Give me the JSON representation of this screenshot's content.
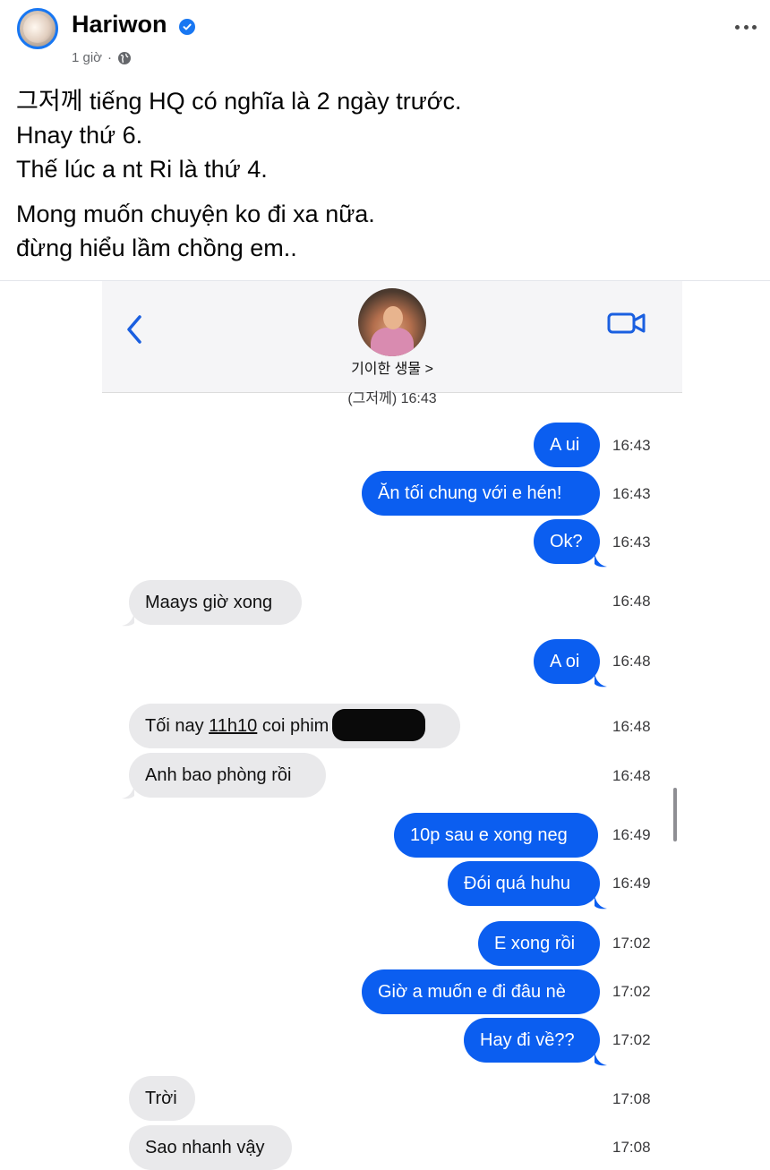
{
  "post": {
    "author": "Hariwon",
    "time": "1 giờ",
    "separator": "·",
    "lines_1": [
      "그저께 tiếng HQ có nghĩa là 2 ngày trước.",
      "Hnay thứ 6.",
      "Thế lúc a nt Ri là thứ 4."
    ],
    "lines_2": [
      "Mong muốn chuyện ko đi xa nữa.",
      "đừng hiểu lầm chồng em.."
    ]
  },
  "chat": {
    "contact_name": "기이한 생물 >",
    "day_label": "(그저께) 16:43",
    "messages": [
      {
        "dir": "out",
        "text": "A ui",
        "time": "16:43"
      },
      {
        "dir": "out",
        "text": "Ăn tối chung với e hén!",
        "time": "16:43"
      },
      {
        "dir": "out",
        "text": "Ok?",
        "time": "16:43"
      },
      {
        "dir": "in",
        "text": "Maays giờ xong",
        "time": "16:48"
      },
      {
        "dir": "out",
        "text": "A oi",
        "time": "16:48"
      },
      {
        "dir": "in",
        "text_pre": "Tối nay ",
        "text_u": "11h10",
        "text_post": " coi phim",
        "time": "16:48"
      },
      {
        "dir": "in",
        "text": "Anh bao phòng rồi",
        "time": "16:48"
      },
      {
        "dir": "out",
        "text": "10p sau e xong neg",
        "time": "16:49"
      },
      {
        "dir": "out",
        "text": "Đói quá huhu",
        "time": "16:49"
      },
      {
        "dir": "out",
        "text": "E xong rồi",
        "time": "17:02"
      },
      {
        "dir": "out",
        "text": "Giờ a muốn e đi đâu nè",
        "time": "17:02"
      },
      {
        "dir": "out",
        "text": "Hay đi về??",
        "time": "17:02"
      },
      {
        "dir": "in",
        "text": "Trời",
        "time": "17:08"
      },
      {
        "dir": "in",
        "text": "Sao nhanh vậy",
        "time": "17:08"
      }
    ]
  },
  "colors": {
    "outgoing": "#0b5ef0",
    "incoming": "#e9e9eb",
    "accent": "#1877f2"
  },
  "icons": [
    "verified-badge-icon",
    "globe-icon",
    "more-options-icon",
    "back-chevron-icon",
    "video-call-icon"
  ]
}
